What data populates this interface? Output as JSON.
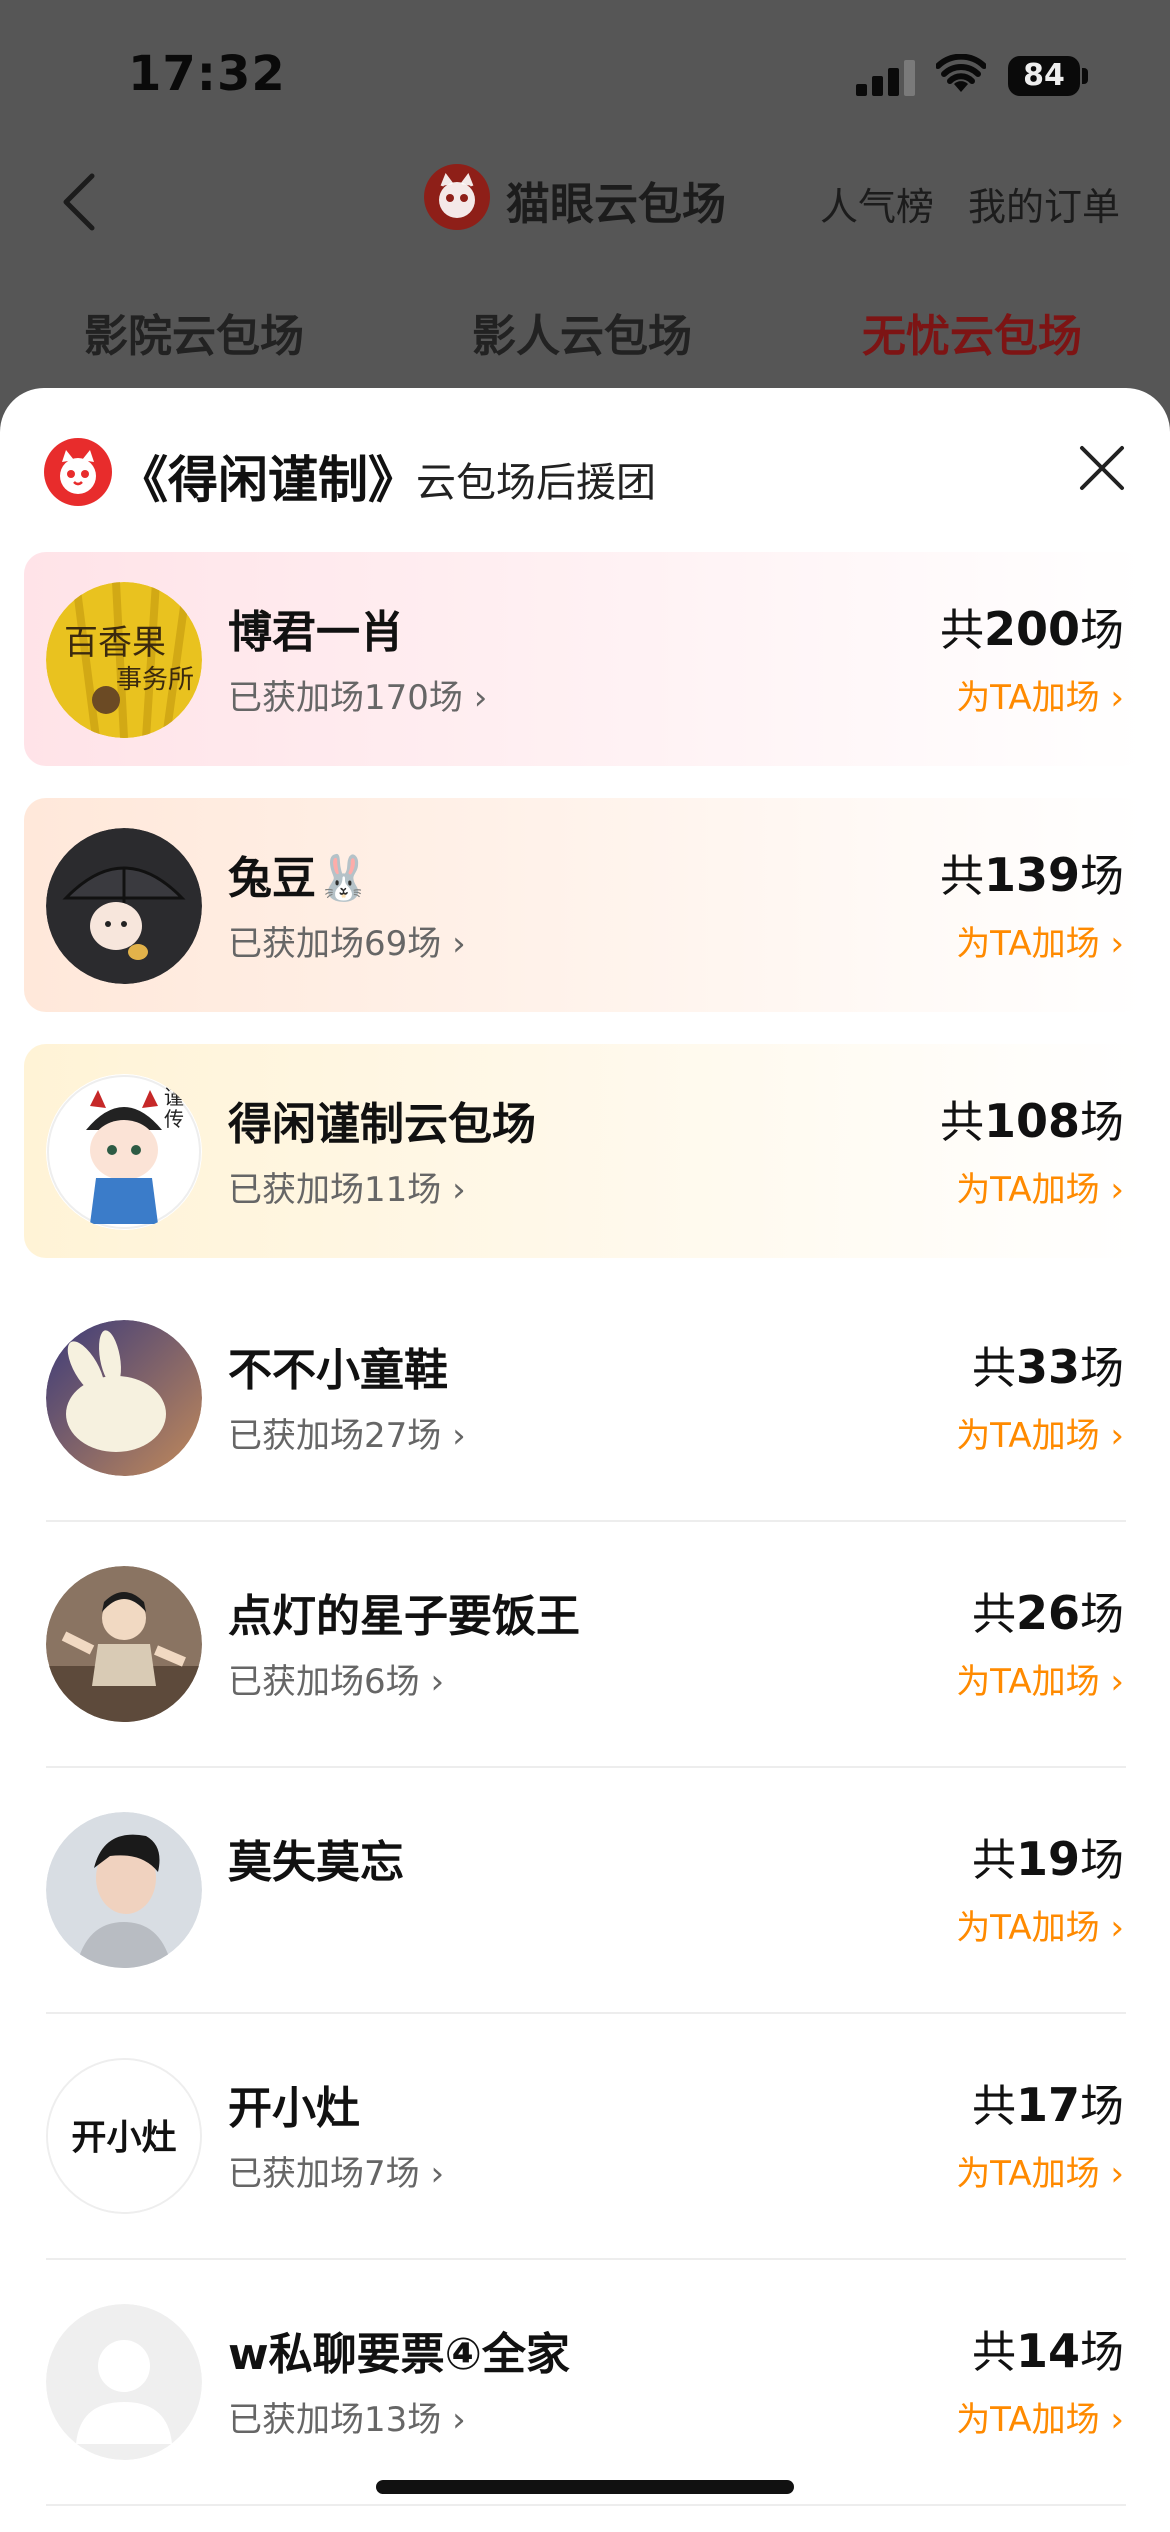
{
  "status_bar": {
    "time": "17:32",
    "battery": "84"
  },
  "nav": {
    "title": "猫眼云包场",
    "links": [
      "人气榜",
      "我的订单"
    ]
  },
  "tabs": [
    {
      "label": "影院云包场",
      "active": false
    },
    {
      "label": "影人云包场",
      "active": false
    },
    {
      "label": "无忧云包场",
      "active": true
    }
  ],
  "sheet": {
    "title": "《得闲谨制》",
    "subtitle": "云包场后援团"
  },
  "supporters": [
    {
      "name": "博君一肖",
      "added": "已获加场170场",
      "total_prefix": "共",
      "total_num": "200",
      "total_suffix": "场",
      "action": "为TA加场",
      "avatar_text": "百香果 事务所"
    },
    {
      "name": "兔豆🐰",
      "added": "已获加场69场",
      "total_prefix": "共",
      "total_num": "139",
      "total_suffix": "场",
      "action": "为TA加场"
    },
    {
      "name": "得闲谨制云包场",
      "added": "已获加场11场",
      "total_prefix": "共",
      "total_num": "108",
      "total_suffix": "场",
      "action": "为TA加场",
      "avatar_text": "谨传"
    },
    {
      "name": "不不小童鞋",
      "added": "已获加场27场",
      "total_prefix": "共",
      "total_num": "33",
      "total_suffix": "场",
      "action": "为TA加场"
    },
    {
      "name": "点灯的星子要饭王",
      "added": "已获加场6场",
      "total_prefix": "共",
      "total_num": "26",
      "total_suffix": "场",
      "action": "为TA加场"
    },
    {
      "name": "莫失莫忘",
      "added": "",
      "total_prefix": "共",
      "total_num": "19",
      "total_suffix": "场",
      "action": "为TA加场"
    },
    {
      "name": "开小灶",
      "added": "已获加场7场",
      "total_prefix": "共",
      "total_num": "17",
      "total_suffix": "场",
      "action": "为TA加场",
      "avatar_text": "开小灶"
    },
    {
      "name": "w私聊要票④全家",
      "added": "已获加场13场",
      "total_prefix": "共",
      "total_num": "14",
      "total_suffix": "场",
      "action": "为TA加场"
    }
  ],
  "colors": {
    "accent_orange": "#ff8a00",
    "brand_red": "#e82c2c",
    "active_tab": "#7d1414"
  }
}
